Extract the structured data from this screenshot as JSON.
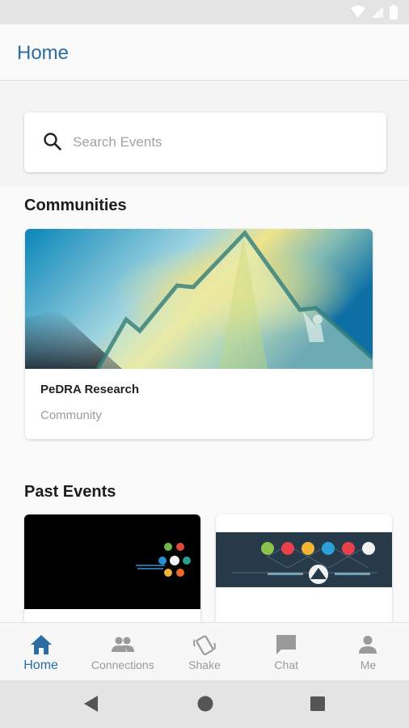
{
  "app_bar": {
    "title": "Home"
  },
  "search": {
    "placeholder": "Search Events",
    "value": ""
  },
  "communities": {
    "title": "Communities",
    "items": [
      {
        "name": "PeDRA Research",
        "type": "Community"
      }
    ]
  },
  "past_events": {
    "title": "Past Events"
  },
  "bottom_nav": {
    "items": [
      {
        "label": "Home",
        "icon": "home-icon",
        "active": true
      },
      {
        "label": "Connections",
        "icon": "people-icon",
        "active": false
      },
      {
        "label": "Shake",
        "icon": "shake-phone-icon",
        "active": false
      },
      {
        "label": "Chat",
        "icon": "chat-icon",
        "active": false
      },
      {
        "label": "Me",
        "icon": "person-icon",
        "active": false
      }
    ]
  },
  "colors": {
    "accent": "#2b6ca3",
    "inactive": "#9a9a9a",
    "background": "#fafafa"
  }
}
